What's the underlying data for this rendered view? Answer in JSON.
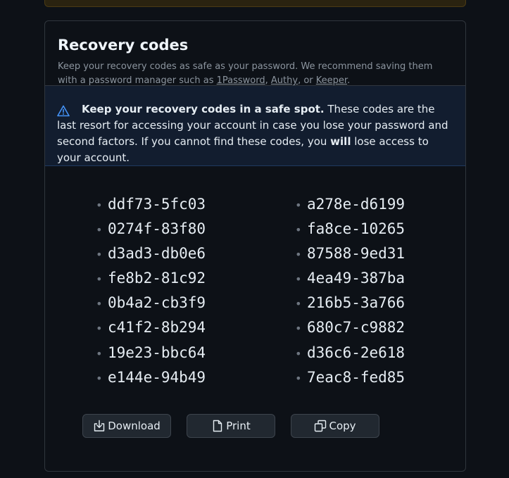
{
  "panel": {
    "title": "Recovery codes",
    "description_prefix": "Keep your recovery codes as safe as your password. We recommend saving them with a password manager such as ",
    "managers": [
      "1Password",
      "Authy",
      "Keeper"
    ],
    "sep_comma": ", ",
    "sep_or": ", or ",
    "period": "."
  },
  "warning": {
    "strong": "Keep your recovery codes in a safe spot.",
    "text_part1": " These codes are the last resort for accessing your account in case you lose your password and second factors. If you cannot find these codes, you ",
    "will": "will",
    "text_part2": " lose access to your account."
  },
  "codes": {
    "left": [
      "ddf73-5fc03",
      "0274f-83f80",
      "d3ad3-db0e6",
      "fe8b2-81c92",
      "0b4a2-cb3f9",
      "c41f2-8b294",
      "19e23-bbc64",
      "e144e-94b49"
    ],
    "right": [
      "a278e-d6199",
      "fa8ce-10265",
      "87588-9ed31",
      "4ea49-387ba",
      "216b5-3a766",
      "680c7-c9882",
      "d36c6-2e618",
      "7eac8-fed85"
    ],
    "bullet": "•"
  },
  "actions": {
    "download_label": "Download",
    "print_label": "Print",
    "copy_label": "Copy"
  },
  "colors": {
    "background": "#0d1117",
    "border": "#30363d",
    "warning_bg": "#121d2f",
    "warning_icon": "#4493f8",
    "button_bg": "#212830"
  },
  "icons": {
    "warning": "alert-triangle-icon",
    "download": "download-icon",
    "print": "file-icon",
    "copy": "copy-icon"
  }
}
